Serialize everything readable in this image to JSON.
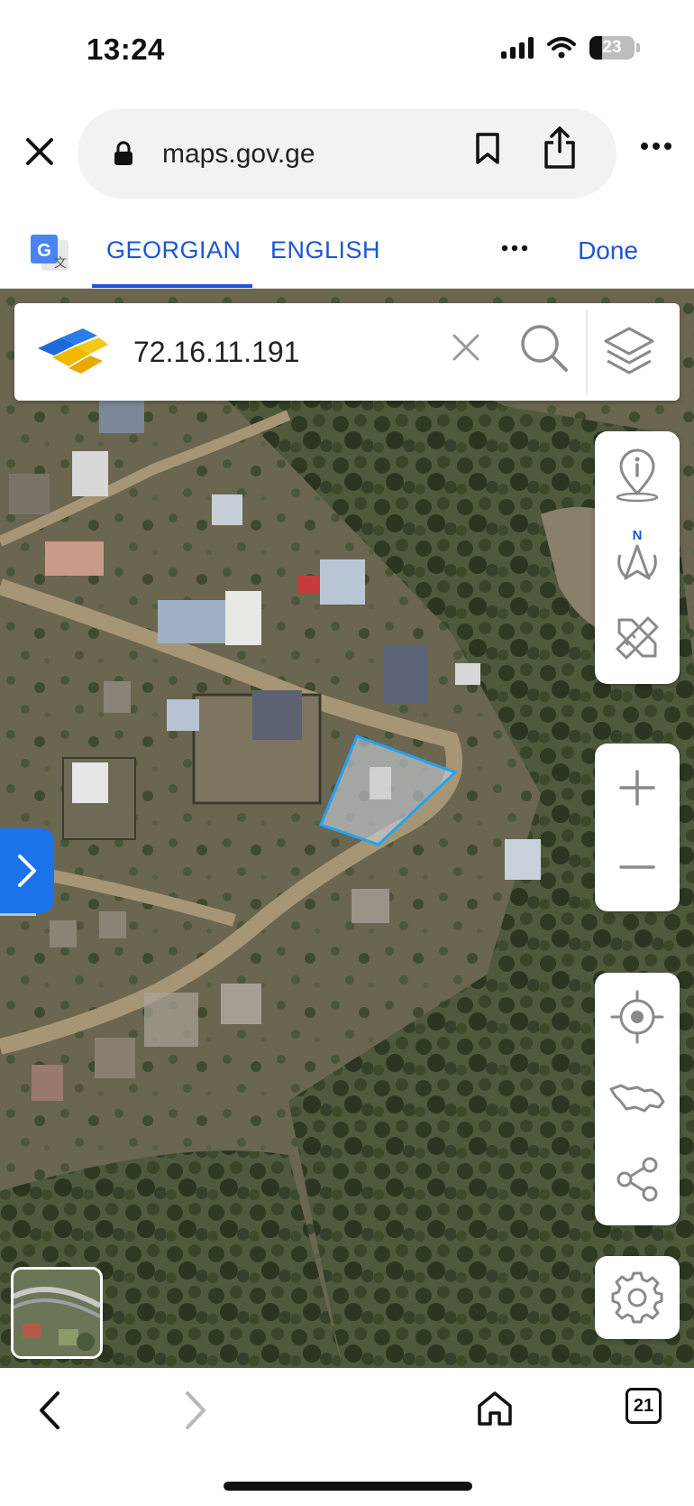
{
  "status_bar": {
    "time": "13:24",
    "battery": "23"
  },
  "browser": {
    "url": "maps.gov.ge"
  },
  "translate_bar": {
    "tab_georgian": "GEORGIAN",
    "tab_english": "ENGLISH",
    "done_label": "Done"
  },
  "map": {
    "search": {
      "value": "72.16.11.191"
    },
    "panel_top": [
      "info-location-icon",
      "compass-north-icon",
      "ruler-pencil-icon"
    ],
    "compass_label": "N",
    "zoom": [
      "zoom-in-icon",
      "zoom-out-icon"
    ],
    "panel_bottom": [
      "locate-me-icon",
      "georgia-map-icon",
      "share-icon"
    ],
    "settings_icon": "gear-icon",
    "accent_color": "#1a73e8"
  },
  "bottom_bar": {
    "tabs_count": "21"
  }
}
